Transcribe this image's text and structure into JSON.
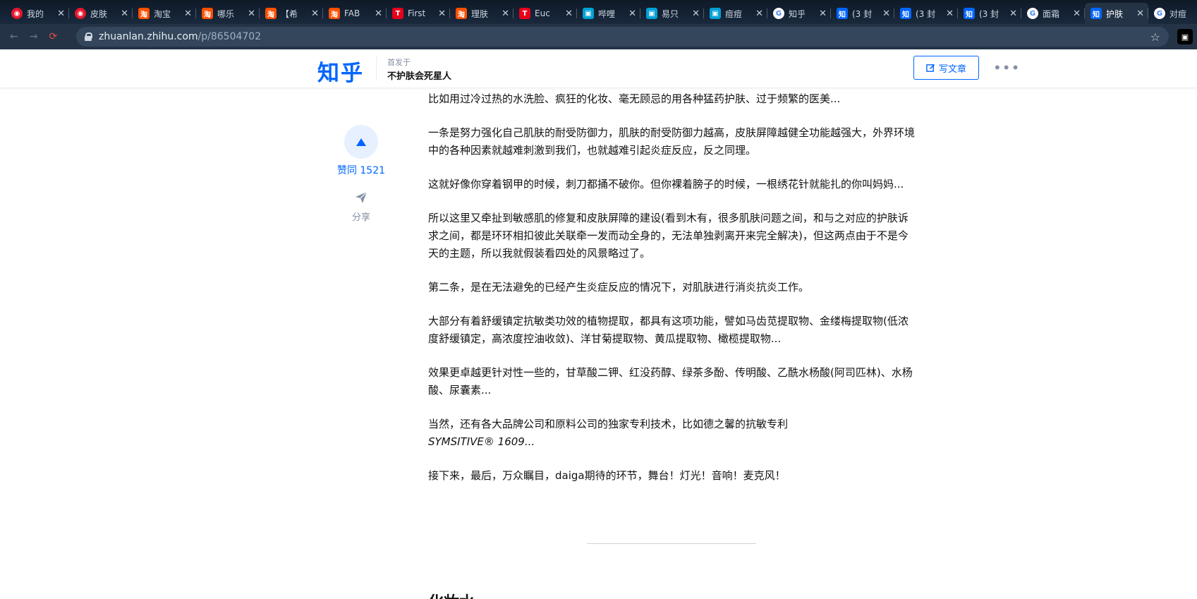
{
  "browser": {
    "tabs": [
      {
        "title": "我的",
        "icon": "weibo-icon",
        "color": "#e6162d",
        "glyph": "◉"
      },
      {
        "title": "皮肤",
        "icon": "weibo-icon",
        "color": "#e6162d",
        "glyph": "◉"
      },
      {
        "title": "淘宝",
        "icon": "taobao-icon",
        "color": "#ff5000",
        "glyph": "淘"
      },
      {
        "title": "哪乐",
        "icon": "taobao-icon",
        "color": "#ff5000",
        "glyph": "淘"
      },
      {
        "title": "【希",
        "icon": "taobao-icon",
        "color": "#ff5000",
        "glyph": "淘"
      },
      {
        "title": "FAB",
        "icon": "taobao-icon",
        "color": "#ff5000",
        "glyph": "淘"
      },
      {
        "title": "First",
        "icon": "tmall-icon",
        "color": "#e8001c",
        "glyph": "T"
      },
      {
        "title": "理肤",
        "icon": "taobao-icon",
        "color": "#ff5000",
        "glyph": "淘"
      },
      {
        "title": "Euc",
        "icon": "tmall-icon",
        "color": "#e8001c",
        "glyph": "T"
      },
      {
        "title": "哔哩",
        "icon": "bilibili-icon",
        "color": "#00a1d6",
        "glyph": "▣"
      },
      {
        "title": "易只",
        "icon": "bilibili-icon",
        "color": "#00a1d6",
        "glyph": "▣"
      },
      {
        "title": "痘痘",
        "icon": "bilibili-icon",
        "color": "#00a1d6",
        "glyph": "▣"
      },
      {
        "title": "知乎",
        "icon": "google-icon",
        "color": "#ffffff",
        "glyph": "G"
      },
      {
        "title": "(3 封",
        "icon": "zhihu-icon",
        "color": "#0066ff",
        "glyph": "知"
      },
      {
        "title": "(3 封",
        "icon": "zhihu-icon",
        "color": "#0066ff",
        "glyph": "知"
      },
      {
        "title": "(3 封",
        "icon": "zhihu-icon",
        "color": "#0066ff",
        "glyph": "知"
      },
      {
        "title": "面霜",
        "icon": "google-icon",
        "color": "#ffffff",
        "glyph": "G"
      },
      {
        "title": "护肤",
        "icon": "zhihu-icon",
        "color": "#0066ff",
        "glyph": "知",
        "active": true
      },
      {
        "title": "对痘",
        "icon": "google-icon",
        "color": "#ffffff",
        "glyph": "G"
      }
    ],
    "url_host": "zhuanlan.zhihu.com",
    "url_path": "/p/86504702"
  },
  "header": {
    "logo": "知乎",
    "first_published_label": "首发于",
    "column_name": "不护肤会死星人",
    "write_button": "写文章",
    "more": "•••"
  },
  "actions": {
    "vote_label": "赞同 1521",
    "share_label": "分享"
  },
  "article": {
    "paragraphs": [
      "比如用过冷过热的水洗脸、疯狂的化妆、毫无顾忌的用各种猛药护肤、过于频繁的医美...",
      "一条是努力强化自己肌肤的耐受防御力，肌肤的耐受防御力越高，皮肤屏障越健全功能越强大，外界环境中的各种因素就越难刺激到我们，也就越难引起炎症反应，反之同理。",
      "这就好像你穿着钢甲的时候，刺刀都捅不破你。但你裸着膀子的时候，一根绣花针就能扎的你叫妈妈...",
      "所以这里又牵扯到敏感肌的修复和皮肤屏障的建设(看到木有，很多肌肤问题之间，和与之对应的护肤诉求之间，都是环环相扣彼此关联牵一发而动全身的，无法单独剥离开来完全解决)，但这两点由于不是今天的主题，所以我就假装看四处的风景略过了。",
      "第二条，是在无法避免的已经产生炎症反应的情况下，对肌肤进行消炎抗炎工作。",
      "大部分有着舒缓镇定抗敏类功效的植物提取，都具有这项功能，譬如马齿苋提取物、金缕梅提取物(低浓度舒缓镇定，高浓度控油收敛)、洋甘菊提取物、黄瓜提取物、橄榄提取物...",
      "效果更卓越更针对性一些的，甘草酸二钾、红没药醇、绿茶多酚、传明酸、乙酰水杨酸(阿司匹林)、水杨酸、尿囊素...",
      "当然，还有各大品牌公司和原料公司的独家专利技术，比如德之馨的抗敏专利",
      "接下来，最后，万众瞩目，daiga期待的环节，舞台！灯光！音响！麦克风！"
    ],
    "patent_italic": "SYMSITIVE® 1609...",
    "next_section_title": "化妆水"
  }
}
